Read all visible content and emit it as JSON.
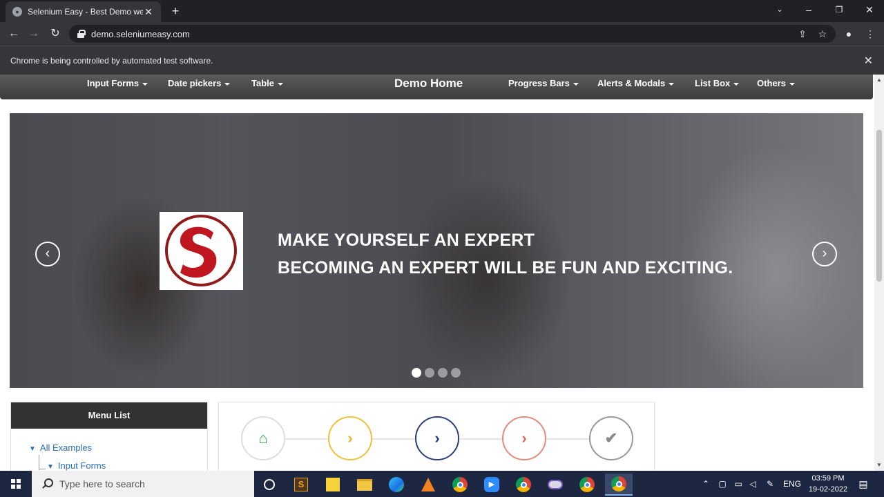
{
  "browser": {
    "tab_title": "Selenium Easy - Best Demo webs",
    "url": "demo.seleniumeasy.com",
    "infobar_text": "Chrome is being controlled by automated test software."
  },
  "navbar": {
    "items_left": [
      "Input Forms",
      "Date pickers",
      "Table"
    ],
    "brand": "Demo Home",
    "items_right": [
      "Progress Bars",
      "Alerts & Modals",
      "List Box",
      "Others"
    ]
  },
  "carousel": {
    "line1": "MAKE YOURSELF AN EXPERT",
    "line2": "BECOMING AN EXPERT WILL BE FUN AND EXCITING.",
    "slide_count": 4,
    "active_slide": 1
  },
  "menu_list": {
    "header": "Menu List",
    "items": [
      {
        "label": "All Examples"
      },
      {
        "label": "Input Forms"
      }
    ]
  },
  "steps": [
    {
      "icon": "home-icon",
      "color": "#2eaa3c",
      "border": "#dddddd"
    },
    {
      "icon": "chevron-right-icon",
      "color": "#f0b622",
      "border": "#f0c03a"
    },
    {
      "icon": "chevron-right-icon",
      "color": "#2b3e7e",
      "border": "#2b3e7e"
    },
    {
      "icon": "chevron-right-icon",
      "color": "#e06a5a",
      "border": "#e38a7d"
    },
    {
      "icon": "check-icon",
      "color": "#888888",
      "border": "#999999"
    }
  ],
  "taskbar": {
    "search_placeholder": "Type here to search",
    "language": "ENG",
    "time": "03:59 PM",
    "date": "19-02-2022"
  }
}
